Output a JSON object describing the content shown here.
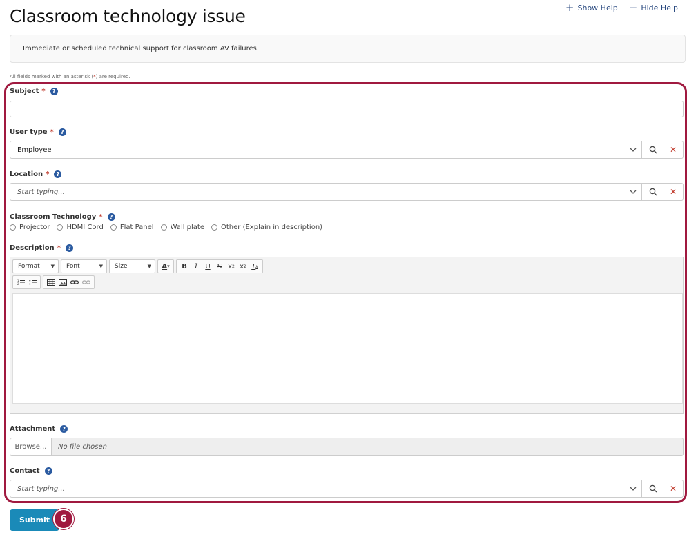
{
  "title": "Classroom technology issue",
  "help": {
    "show": "Show Help",
    "hide": "Hide Help"
  },
  "description": "Immediate or scheduled technical support for classroom AV failures.",
  "required_note": {
    "prefix": "All fields marked with an asterisk (",
    "asterisk": "*",
    "suffix": ") are required."
  },
  "fields": {
    "subject": {
      "label": "Subject",
      "required": "*",
      "value": ""
    },
    "user_type": {
      "label": "User type",
      "required": "*",
      "value": "Employee"
    },
    "location": {
      "label": "Location",
      "required": "*",
      "placeholder": "Start typing..."
    },
    "classroom_technology": {
      "label": "Classroom Technology",
      "required": "*",
      "options": [
        "Projector",
        "HDMI Cord",
        "Flat Panel",
        "Wall plate",
        "Other (Explain in description)"
      ]
    },
    "description": {
      "label": "Description",
      "required": "*",
      "toolbar": {
        "format": "Format",
        "font": "Font",
        "size": "Size"
      }
    },
    "attachment": {
      "label": "Attachment",
      "browse": "Browse...",
      "no_file": "No file chosen"
    },
    "contact": {
      "label": "Contact",
      "placeholder": "Start typing..."
    }
  },
  "submit_label": "Submit",
  "step_number": "6",
  "icons": [
    "plus-icon",
    "minus-icon",
    "help-icon",
    "chevron-down-icon",
    "search-icon",
    "clear-icon",
    "text-color-icon",
    "bold-icon",
    "italic-icon",
    "underline-icon",
    "strikethrough-icon",
    "subscript-icon",
    "superscript-icon",
    "remove-format-icon",
    "numbered-list-icon",
    "bulleted-list-icon",
    "table-icon",
    "image-icon",
    "link-icon",
    "unlink-icon"
  ],
  "colors": {
    "accent": "#a0193f",
    "submit": "#1a8ab8",
    "help_icon": "#2a5aa0",
    "required": "#c0392b"
  }
}
